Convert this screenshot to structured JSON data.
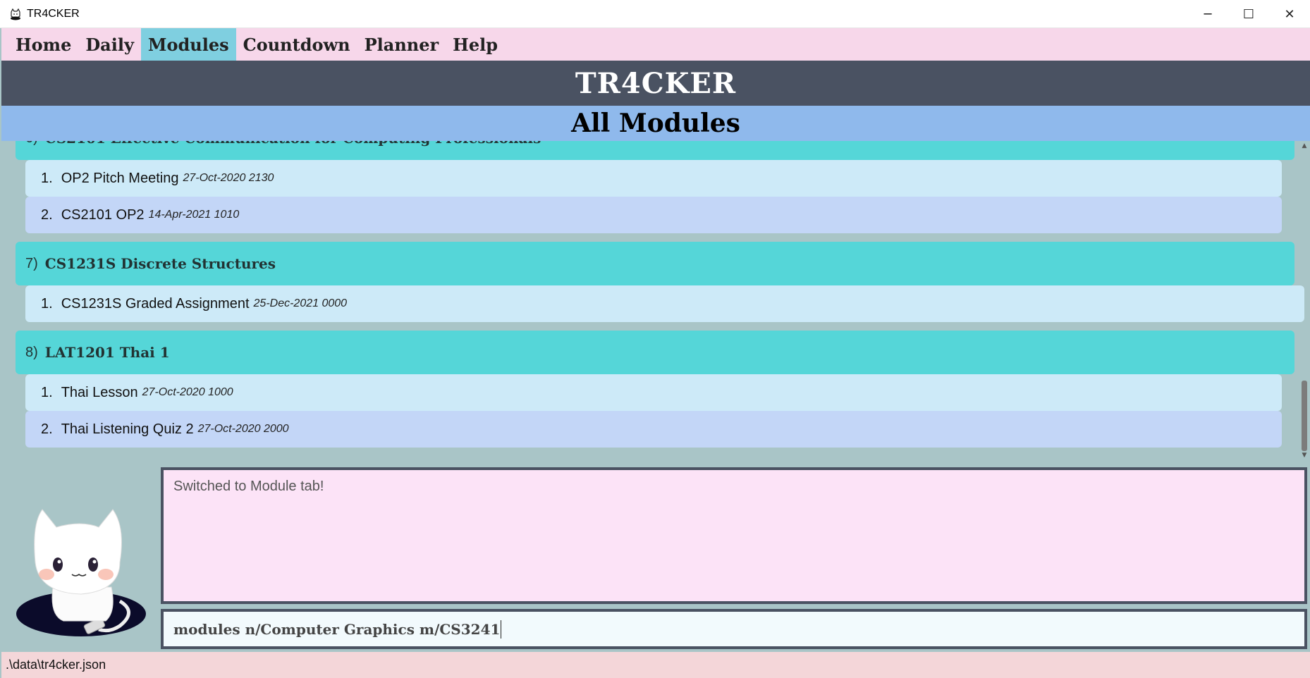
{
  "window": {
    "title": "TR4CKER",
    "controls": {
      "minimize": "─",
      "maximize": "☐",
      "close": "✕"
    }
  },
  "menu": {
    "items": [
      {
        "label": "Home",
        "active": false
      },
      {
        "label": "Daily",
        "active": false
      },
      {
        "label": "Modules",
        "active": true
      },
      {
        "label": "Countdown",
        "active": false
      },
      {
        "label": "Planner",
        "active": false
      },
      {
        "label": "Help",
        "active": false
      }
    ]
  },
  "header": {
    "title": "TR4CKER"
  },
  "subheader": {
    "title": "All Modules"
  },
  "modules": [
    {
      "index": "6)",
      "name": "CS2101 Effective Communication for Computing Professionals",
      "tasks": [
        {
          "index": "1.",
          "name": "OP2 Pitch Meeting",
          "date": "27-Oct-2020 2130"
        },
        {
          "index": "2.",
          "name": "CS2101 OP2",
          "date": "14-Apr-2021 1010"
        }
      ]
    },
    {
      "index": "7)",
      "name": "CS1231S Discrete Structures",
      "tasks": [
        {
          "index": "1.",
          "name": "CS1231S Graded Assignment",
          "date": "25-Dec-2021 0000"
        }
      ]
    },
    {
      "index": "8)",
      "name": "LAT1201 Thai 1",
      "tasks": [
        {
          "index": "1.",
          "name": "Thai Lesson",
          "date": "27-Oct-2020 1000"
        },
        {
          "index": "2.",
          "name": "Thai Listening Quiz 2",
          "date": "27-Oct-2020 2000"
        }
      ]
    }
  ],
  "result": {
    "message": "Switched to Module tab!"
  },
  "command": {
    "value": "modules n/Computer Graphics m/CS3241"
  },
  "status": {
    "path": ".\\data\\tr4cker.json"
  },
  "colors": {
    "menu_bg": "#f7d7ea",
    "menu_active": "#7fcfe0",
    "header_bg": "#4a5262",
    "subheader_bg": "#8fb9ec",
    "module_header": "#55d6d8",
    "task_light": "#cdeaf8",
    "task_alt": "#c3d6f7",
    "result_bg": "#fce3f7",
    "status_bg": "#f4d6d9"
  }
}
